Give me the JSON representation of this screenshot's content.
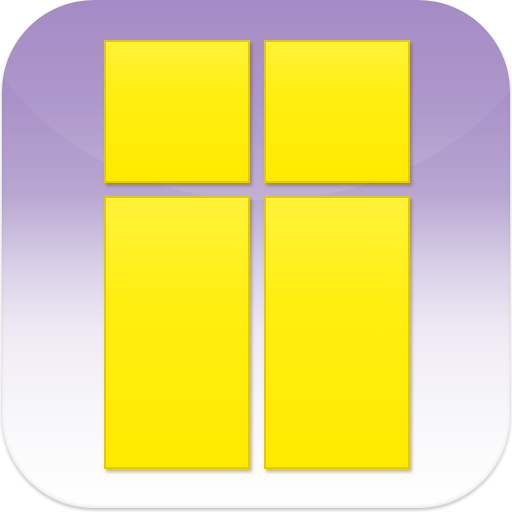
{
  "icon": {
    "name": "four-panel-grid-icon",
    "colors": {
      "background_top": "#a58bc6",
      "background_bottom": "#ffffff",
      "tile_fill": "#ffee10",
      "tile_border": "#e2c900"
    },
    "tiles": [
      "top-left",
      "top-right",
      "bottom-left",
      "bottom-right"
    ]
  }
}
